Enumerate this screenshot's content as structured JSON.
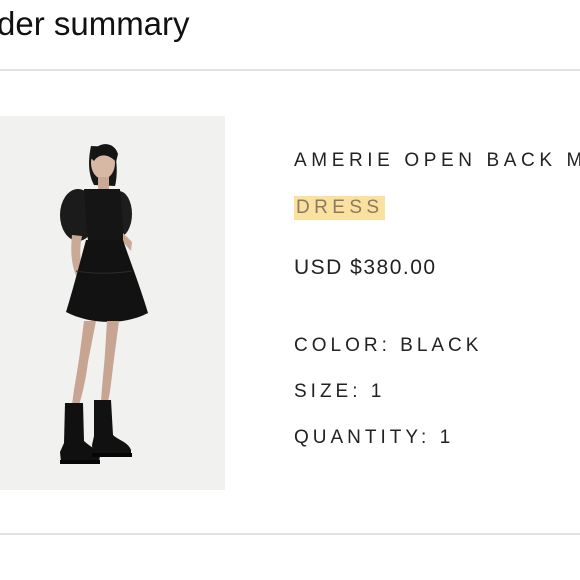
{
  "header": {
    "title": "rder summary"
  },
  "product": {
    "name": "AMERIE OPEN BACK M",
    "category": "DRESS",
    "price": "USD $380.00",
    "color_label": "COLOR:",
    "color_value": "BLACK",
    "size_label": "SIZE:",
    "size_value": "1",
    "quantity_label": "QUANTITY:",
    "quantity_value": "1",
    "highlight_color": "#fbe1a0"
  }
}
